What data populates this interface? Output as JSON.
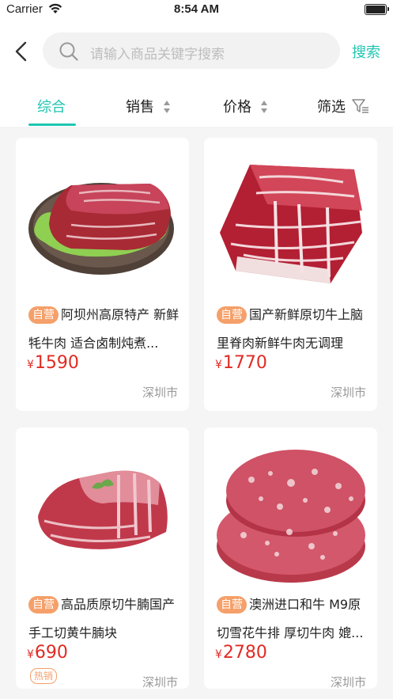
{
  "status_bar": {
    "carrier": "Carrier",
    "time": "8:54 AM"
  },
  "header": {
    "search_placeholder": "请输入商品关键字搜索",
    "search_button": "搜索"
  },
  "tabs": [
    {
      "label": "综合",
      "active": true
    },
    {
      "label": "销售"
    },
    {
      "label": "价格"
    },
    {
      "label": "筛选"
    }
  ],
  "products": [
    {
      "badge": "自营",
      "title": "阿坝州高原特产 新鲜牦牛肉 适合卤制炖煮...",
      "currency": "¥",
      "price": "1590",
      "location": "深圳市",
      "image": "beef-slab-on-lettuce"
    },
    {
      "badge": "自营",
      "title": "国产新鲜原切牛上脑里脊肉新鲜牛肉无调理",
      "currency": "¥",
      "price": "1770",
      "location": "深圳市",
      "image": "marbled-beef-block"
    },
    {
      "badge": "自营",
      "title": "高品质原切牛腩国产手工切黄牛腩块",
      "currency": "¥",
      "price": "690",
      "location": "深圳市",
      "tag": "热销",
      "image": "beef-brisket"
    },
    {
      "badge": "自营",
      "title": "澳洲进口和牛 M9原切雪花牛排 厚切牛肉 媲...",
      "currency": "¥",
      "price": "2780",
      "location": "深圳市",
      "image": "wagyu-steaks"
    }
  ],
  "colors": {
    "accent": "#1fc6b2",
    "price": "#e02b24",
    "badge": "#f5a06a"
  }
}
